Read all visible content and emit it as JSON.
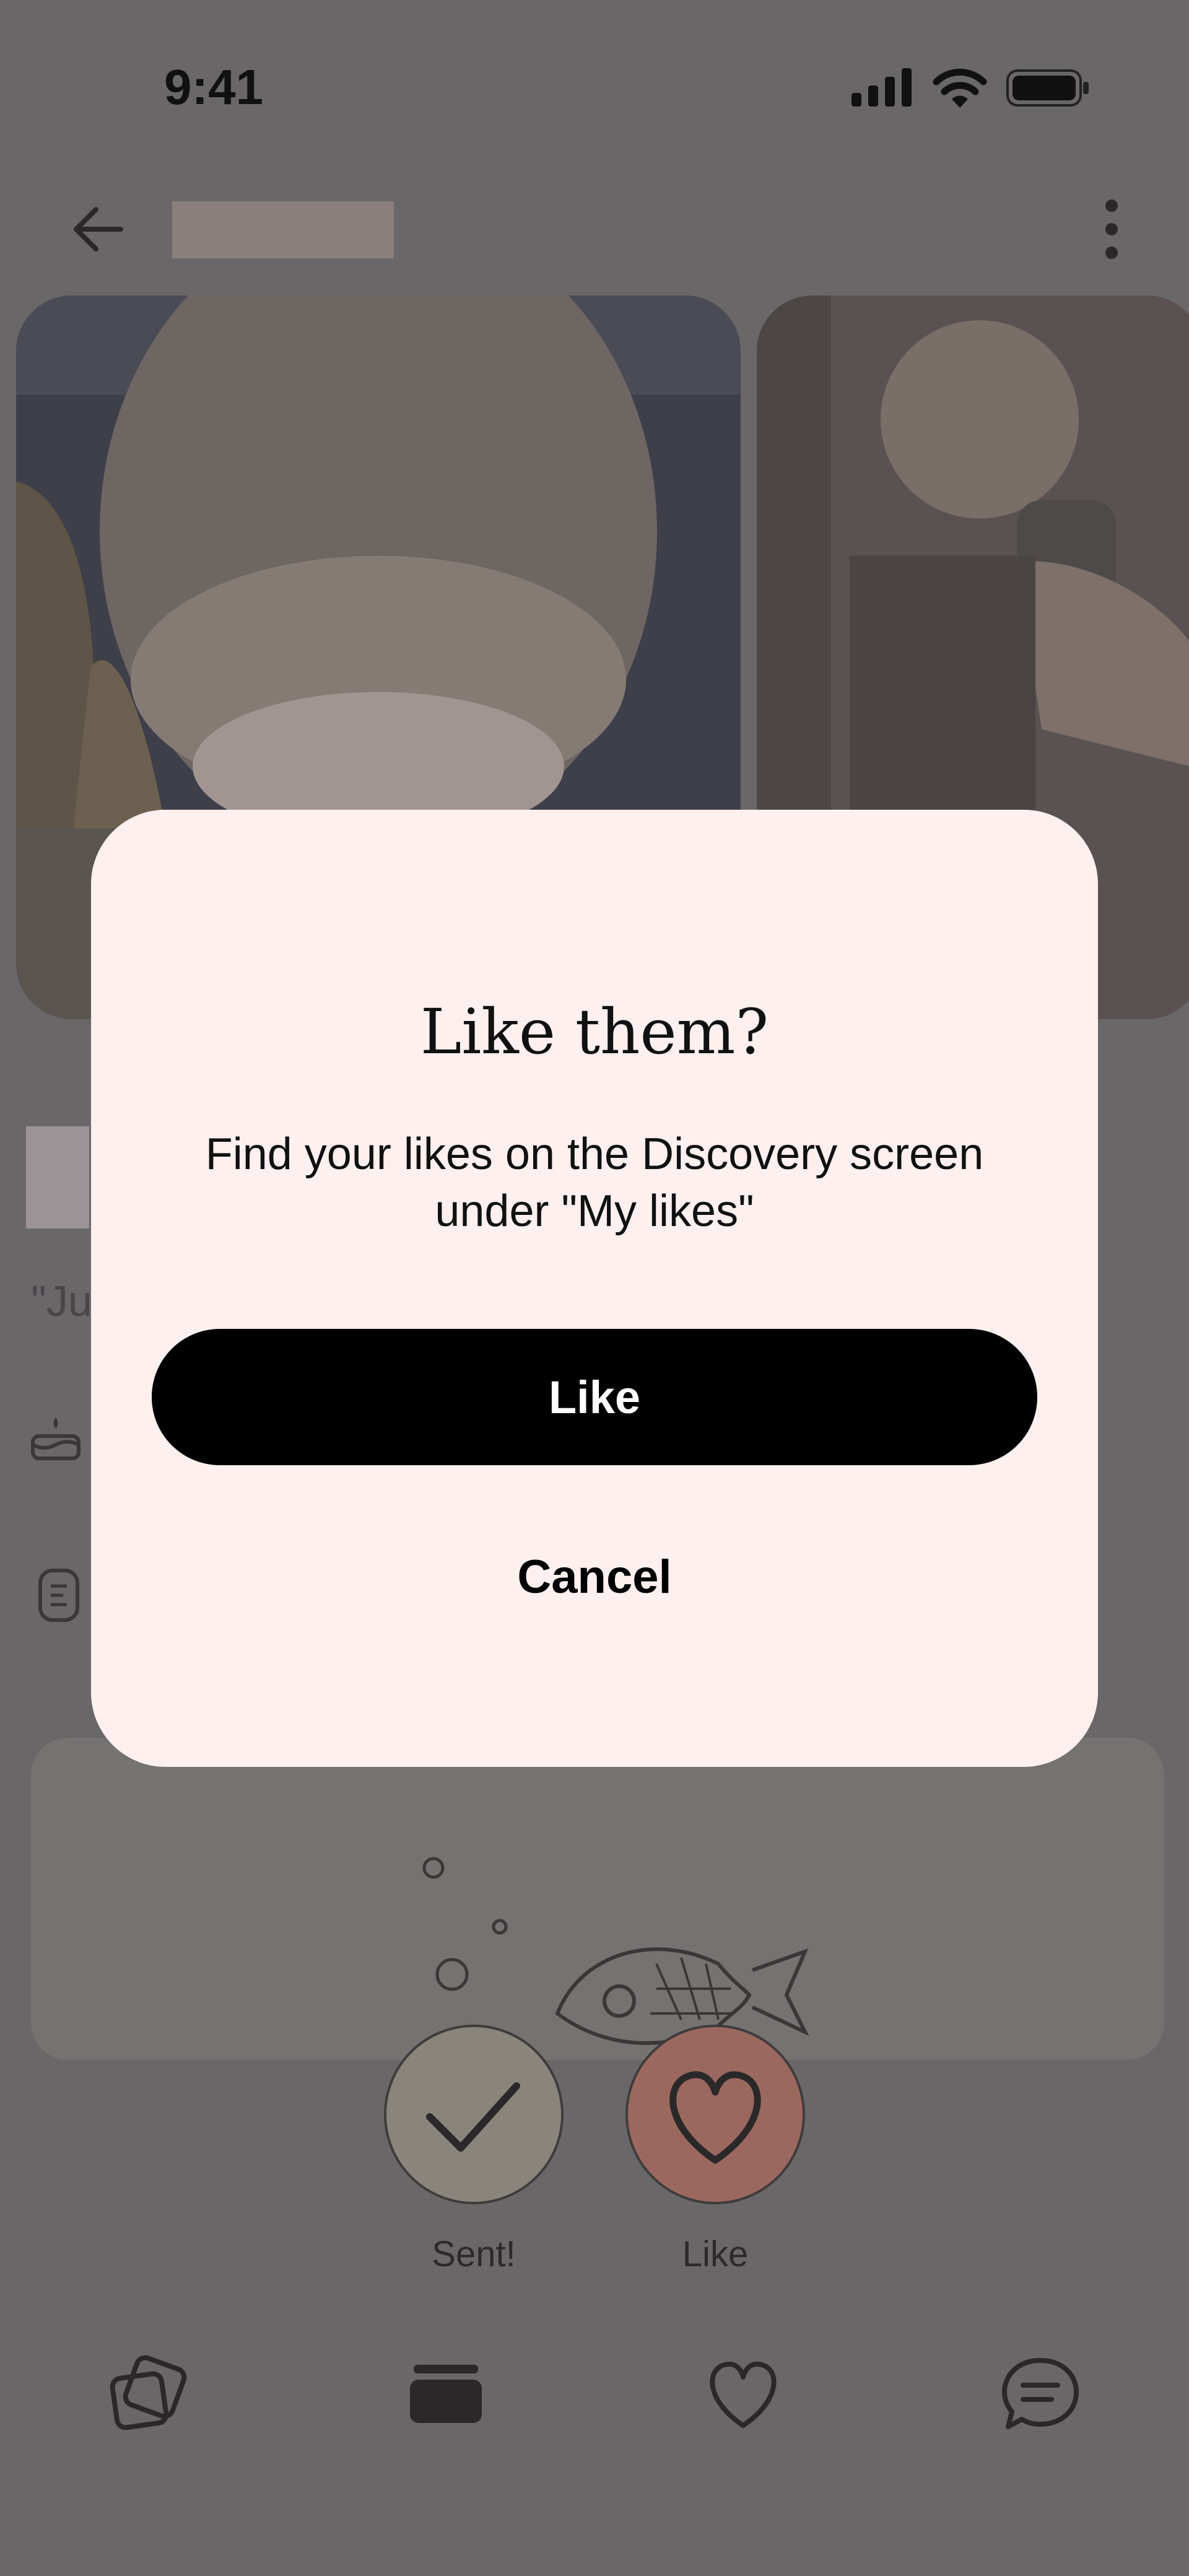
{
  "status_bar": {
    "time": "9:41"
  },
  "profile": {
    "quote_fragment": "\"Ju"
  },
  "actions": {
    "sent_label": "Sent!",
    "like_label": "Like"
  },
  "dialog": {
    "title": "Like them?",
    "message": "Find your likes on the Discovery screen under \"My likes\"",
    "confirm_label": "Like",
    "cancel_label": "Cancel"
  },
  "tab_bar": {
    "items": [
      {
        "icon": "cards-icon"
      },
      {
        "icon": "stack-icon"
      },
      {
        "icon": "heart-icon"
      },
      {
        "icon": "chat-icon"
      }
    ]
  },
  "colors": {
    "overlay": "#6a6768",
    "dialog_bg": "#fdf0ee",
    "primary_button": "#000000",
    "like_button": "#9b6860"
  }
}
